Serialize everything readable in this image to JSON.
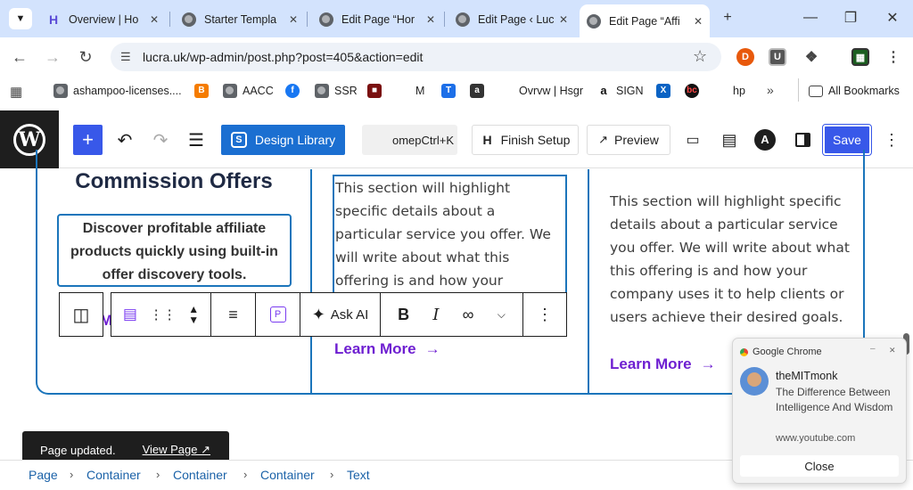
{
  "tabs": [
    {
      "title": "Overview | Ho",
      "icon": "hostinger-icon"
    },
    {
      "title": "Starter Templa",
      "icon": "globe-icon"
    },
    {
      "title": "Edit Page “Hor",
      "icon": "globe-icon"
    },
    {
      "title": "Edit Page ‹ Luc",
      "icon": "globe-icon"
    },
    {
      "title": "Edit Page “Affi",
      "icon": "globe-icon",
      "active": true
    }
  ],
  "address": {
    "url": "lucra.uk/wp-admin/post.php?post=405&action=edit"
  },
  "bookmarks": [
    {
      "label": "ashampoo-licenses....",
      "icon": "globe-icon"
    },
    {
      "label": "",
      "icon": "blogger-icon"
    },
    {
      "label": "AACC",
      "icon": "globe-icon"
    },
    {
      "label": "",
      "icon": "facebook-icon"
    },
    {
      "label": "SSR",
      "icon": "globe-icon"
    },
    {
      "label": "",
      "icon": "dark-square-icon"
    },
    {
      "label": "M",
      "icon": "hostinger-icon"
    },
    {
      "label": "",
      "icon": "t-blue-icon"
    },
    {
      "label": "",
      "icon": "amazon-small-icon"
    },
    {
      "label": "Ovrvw | Hsgr",
      "icon": "hostinger-icon"
    },
    {
      "label": "SIGN",
      "icon": "amazon-icon"
    },
    {
      "label": "",
      "icon": "x-box-icon"
    },
    {
      "label": "",
      "icon": "bc-icon"
    },
    {
      "label": "hp",
      "icon": "hostinger-icon"
    }
  ],
  "all_bookmarks": "All Bookmarks",
  "wp_toolbar": {
    "design_library": "Design Library",
    "command_hint": "omepCtrl+K",
    "finish_setup": "Finish Setup",
    "preview": "Preview",
    "save": "Save"
  },
  "content": {
    "col1_heading": "Commission Offers",
    "col1_box": "Discover profitable affiliate products quickly using built-in offer discovery tools.",
    "col1_link_fragment": "M",
    "col2_text": "This section will highlight specific details about a particular service you offer. We will write about what this offering is and how your company uses it to help clients or",
    "col2_link": "Learn More",
    "col3_text": "This section will highlight specific details about a particular service you offer. We will write about what this offering is and how your company uses it to help clients or users achieve their desired goals.",
    "col3_link": "Learn More"
  },
  "block_toolbar": {
    "ask_ai": "Ask AI"
  },
  "snackbar": {
    "message": "Page updated.",
    "action": "View Page ↗"
  },
  "breadcrumb": [
    "Page",
    "Container",
    "Container",
    "Container",
    "Text"
  ],
  "notification": {
    "app": "Google Chrome",
    "author": "theMITmonk",
    "title": "The Difference Between Intelligence And Wisdom",
    "source": "www.youtube.com",
    "close": "Close"
  },
  "colors": {
    "accent": "#3858e9",
    "link": "#6e1fd1",
    "border": "#1b75bb",
    "tabbar": "#d3e3fd"
  }
}
